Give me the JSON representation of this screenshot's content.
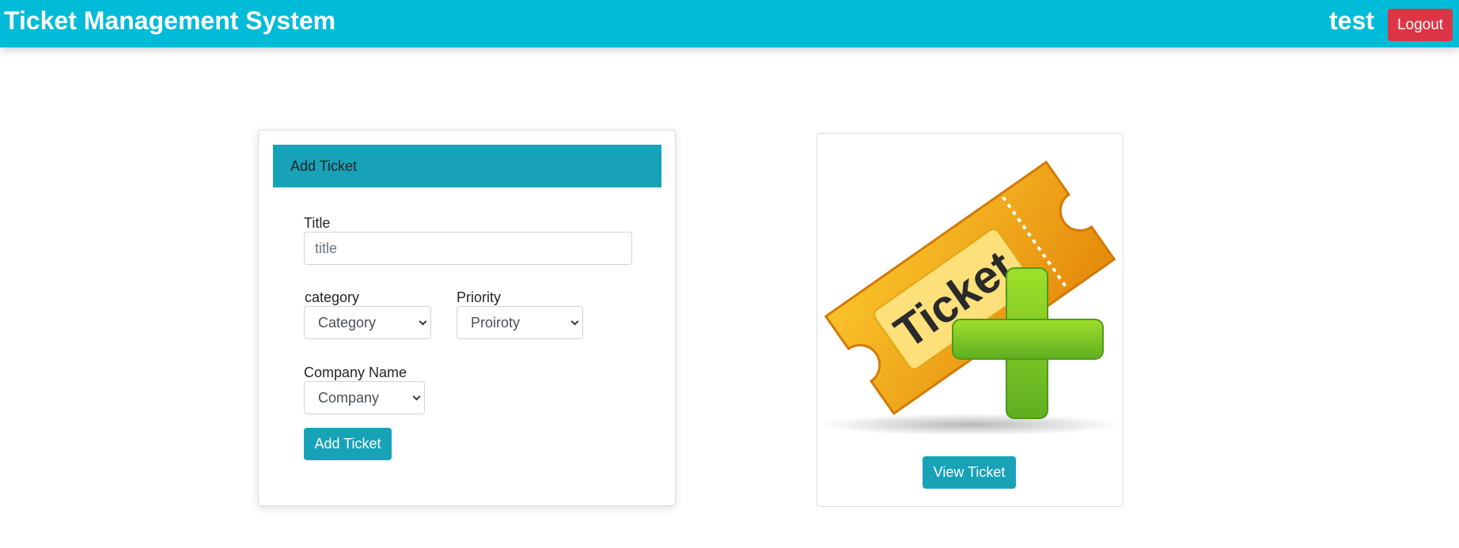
{
  "navbar": {
    "brand": "Ticket Management System",
    "username": "test",
    "logout_label": "Logout"
  },
  "form": {
    "header": "Add Ticket",
    "title_label": "Title",
    "title_placeholder": "title",
    "title_value": "",
    "category_label": "category",
    "category_selected": "Category",
    "priority_label": "Priority",
    "priority_selected": "Proiroty",
    "company_label": "Company Name",
    "company_selected": "Company",
    "submit_label": "Add Ticket"
  },
  "image_card": {
    "ticket_text": "Ticket",
    "view_label": "View Ticket"
  },
  "colors": {
    "navbar_bg": "#00bcd8",
    "accent": "#17a2b8",
    "danger": "#dc3545",
    "ticket_orange": "#f2a51a",
    "plus_green": "#7cc520"
  }
}
